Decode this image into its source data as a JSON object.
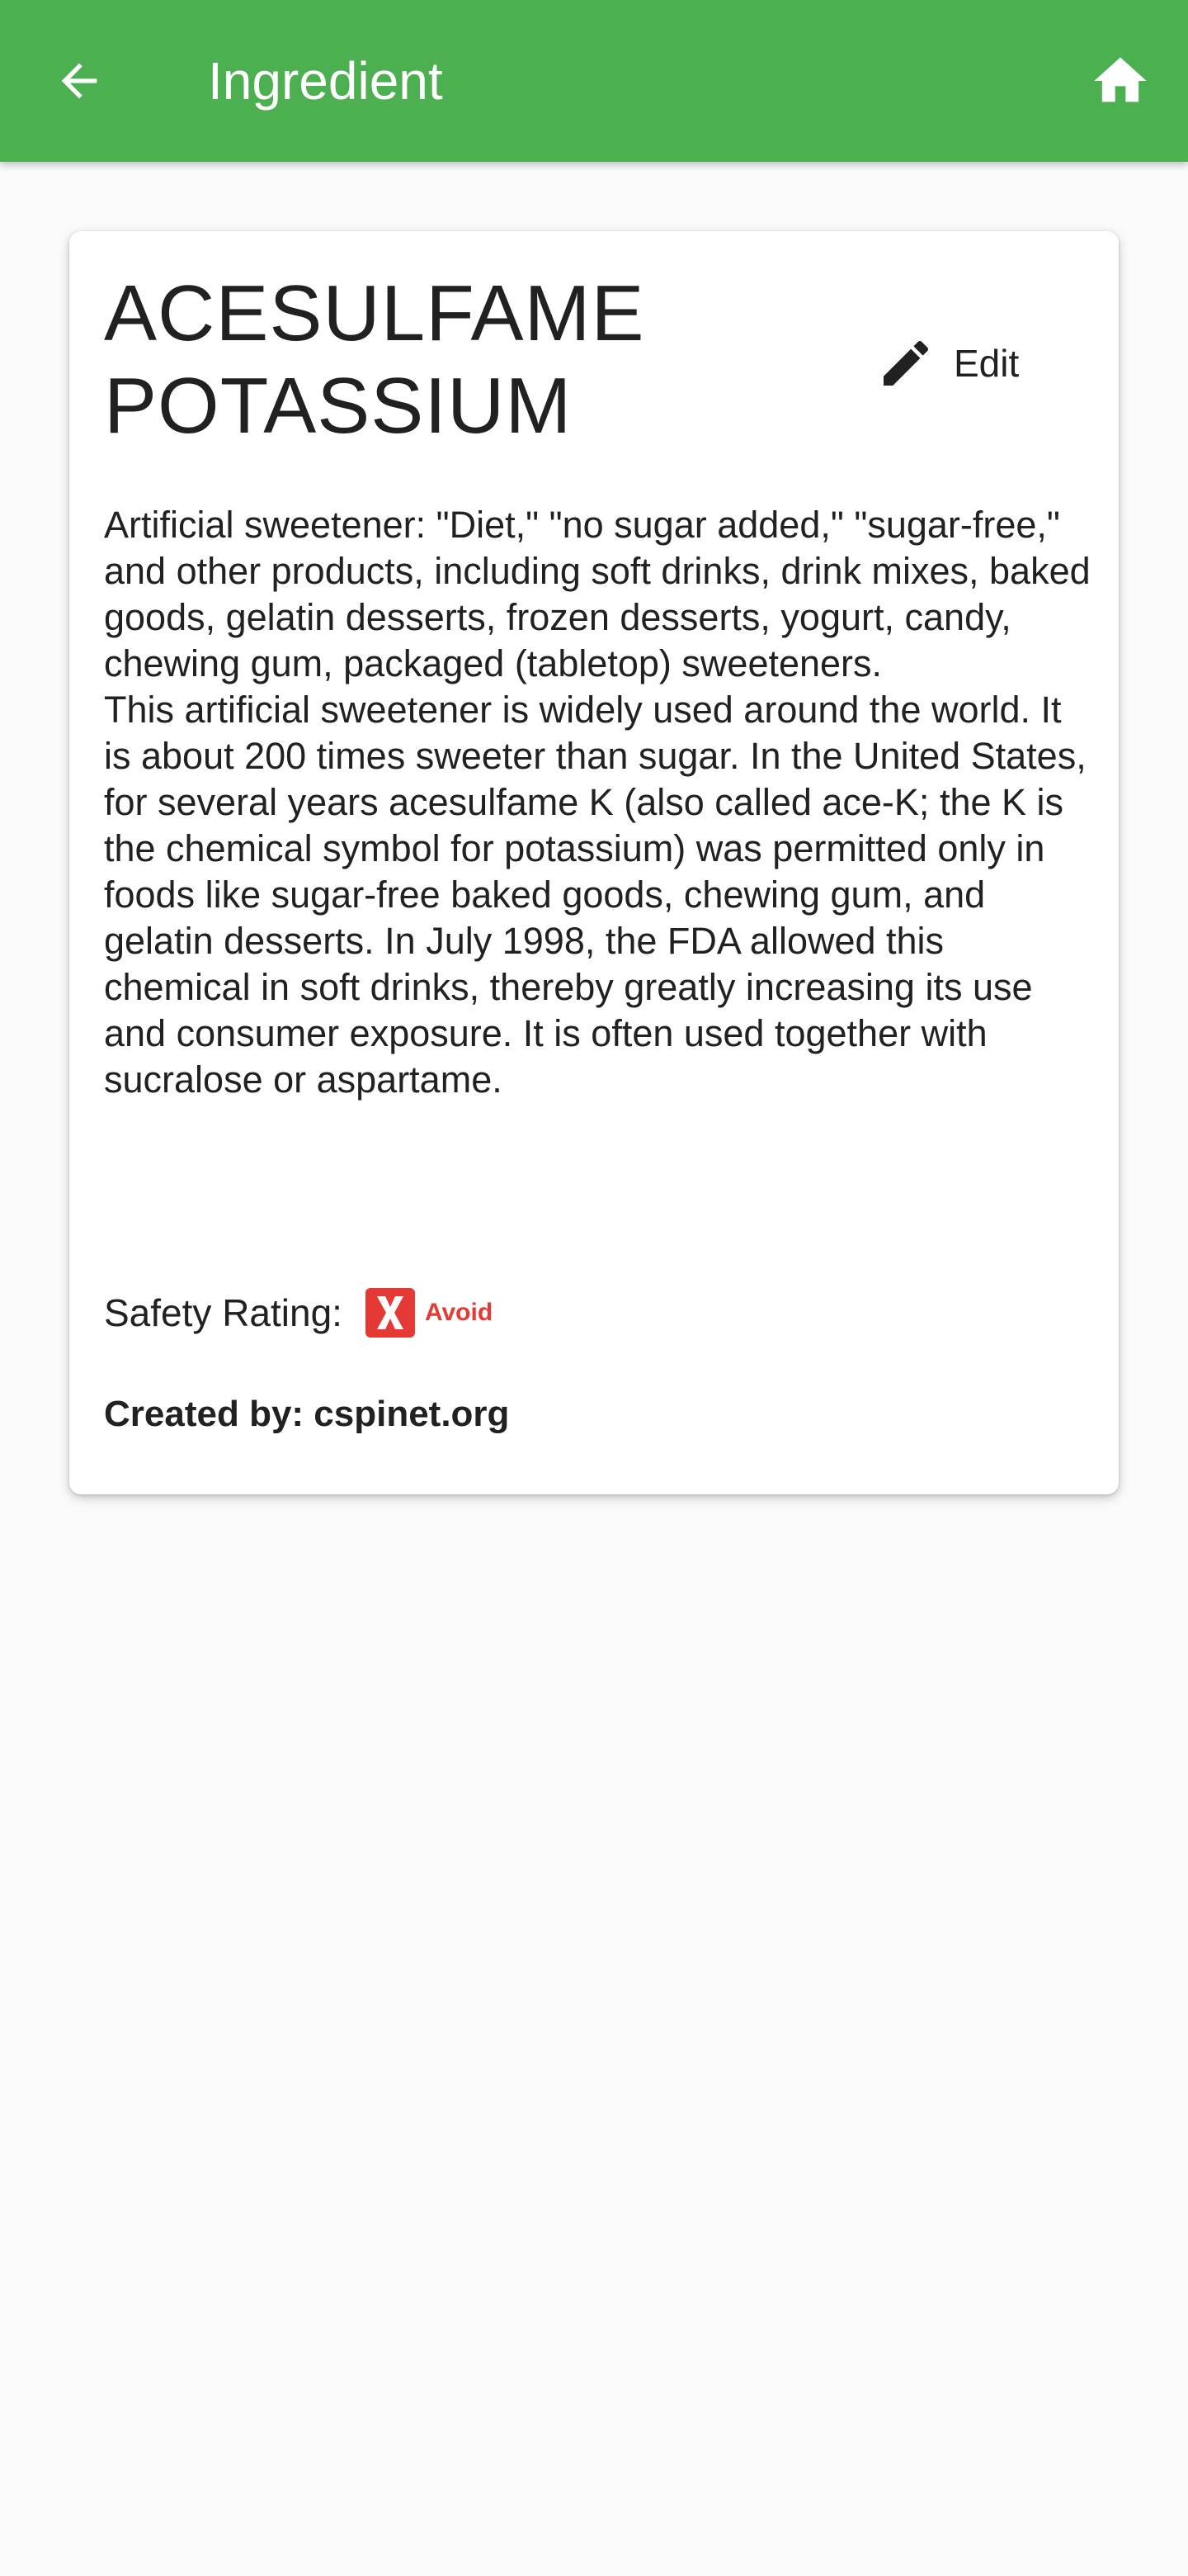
{
  "app_bar": {
    "title": "Ingredient",
    "back_icon": "arrow-left-icon",
    "home_icon": "home-icon",
    "background_color": "#4caf50"
  },
  "ingredient": {
    "name": "ACESULFAME POTASSIUM",
    "edit_label": "Edit",
    "edit_icon": "pencil-icon",
    "description": [
      "Artificial sweetener: \"Diet,\" \"no sugar added,\" \"sugar-free,\" and other products, including soft drinks, drink mixes, baked goods, gelatin desserts, frozen desserts, yogurt, candy, chewing gum, packaged (tabletop) sweeteners.",
      "This artificial sweetener is widely used around the world. It is about 200 times sweeter than sugar. In the United States, for several years acesulfame K (also called ace-K; the K is the chemical symbol for potassium) was permitted only in foods like sugar-free baked goods, chewing gum, and gelatin desserts. In July 1998, the FDA allowed this chemical in soft drinks, thereby greatly increasing its use and consumer exposure. It is often used together with sucralose or aspartame."
    ],
    "safety_label": "Safety Rating:",
    "safety_rating": {
      "icon": "x-avoid-icon",
      "label": "Avoid",
      "color": "#e53935"
    },
    "created_by": "Created by: cspinet.org"
  }
}
